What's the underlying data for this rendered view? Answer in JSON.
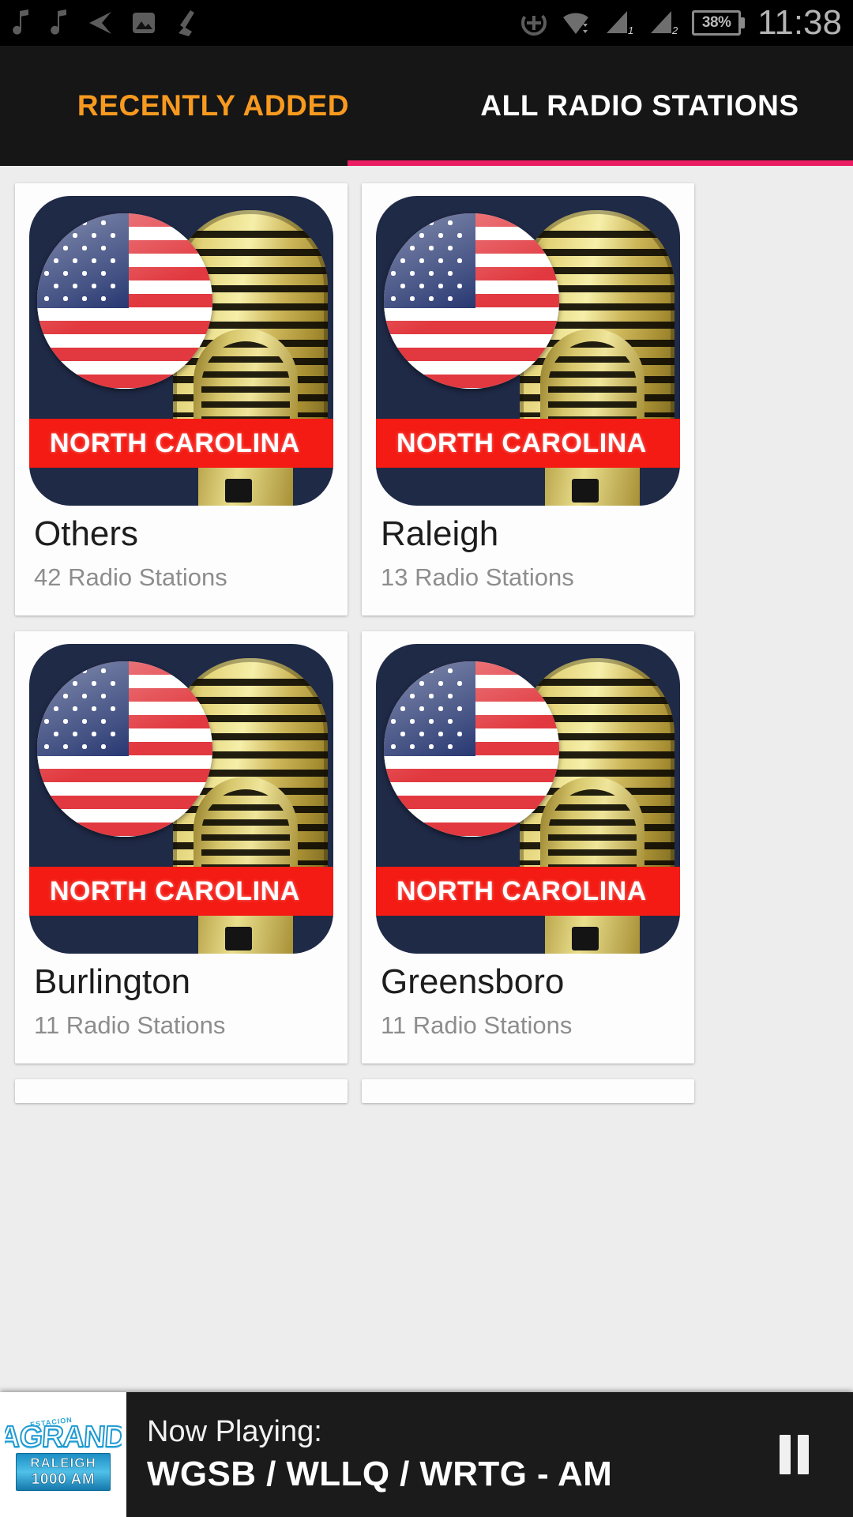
{
  "status_bar": {
    "icons_left": [
      "music-note-icon",
      "music-note-icon",
      "navigation-arrow-icon",
      "image-icon",
      "broom-icon"
    ],
    "icons_right": [
      "location-add-icon",
      "wifi-icon",
      "signal-1-icon",
      "signal-2-icon"
    ],
    "signal_1_label": "1",
    "signal_2_label": "2",
    "battery_percent": "38%",
    "time": "11:38"
  },
  "tabs": [
    {
      "label": "RECENTLY ADDED",
      "state": "inactive",
      "color": "#f79a1f"
    },
    {
      "label": "ALL RADIO STATIONS",
      "state": "active",
      "color": "#ffffff"
    }
  ],
  "tab_indicator_color": "#e91e63",
  "cards": [
    {
      "title": "Others",
      "subtitle": "42 Radio Stations",
      "artwork_banner": "NORTH CAROLINA"
    },
    {
      "title": "Raleigh",
      "subtitle": "13 Radio Stations",
      "artwork_banner": "NORTH CAROLINA"
    },
    {
      "title": "Burlington",
      "subtitle": "11 Radio Stations",
      "artwork_banner": "NORTH CAROLINA"
    },
    {
      "title": "Greensboro",
      "subtitle": "11 Radio Stations",
      "artwork_banner": "NORTH CAROLINA"
    }
  ],
  "now_playing": {
    "label": "Now Playing:",
    "title": "WGSB / WLLQ / WRTG - AM",
    "button_icon": "pause-icon",
    "logo": {
      "top": "ESTACION",
      "main_line1": "LA",
      "main_line2": "GRANDE",
      "city": "RALEIGH",
      "frequency": "1000 AM"
    }
  },
  "colors": {
    "accent_orange": "#f79a1f",
    "accent_pink": "#e91e63",
    "status_bar_bg": "#000000",
    "tab_bar_bg": "#161616",
    "page_bg": "#ededed",
    "card_bg": "#fdfdfd",
    "art_navy": "#1f2a47",
    "art_red": "#f31b13"
  }
}
